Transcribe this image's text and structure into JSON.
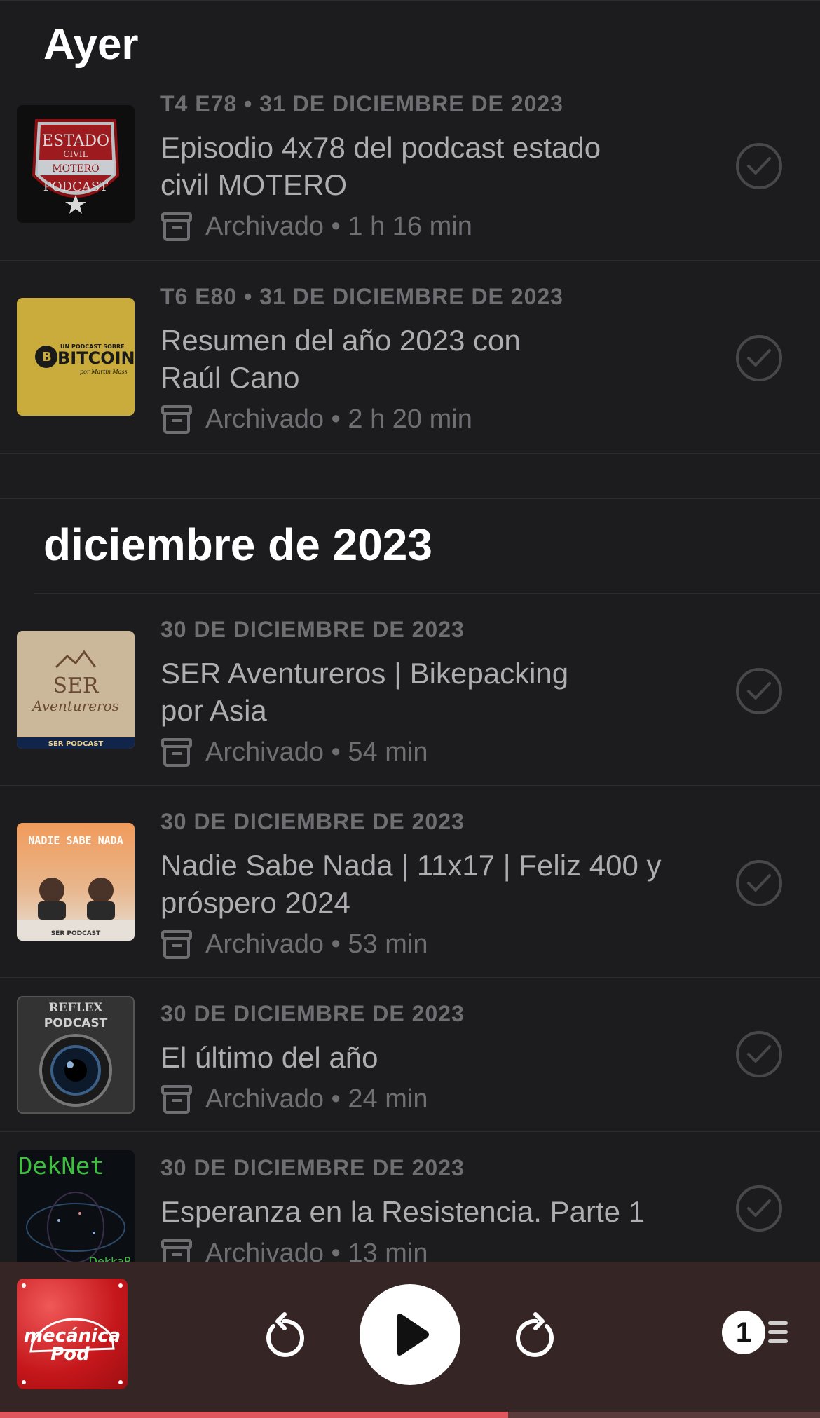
{
  "sections": [
    {
      "title": "Ayer",
      "episodes": [
        {
          "meta": "T4 E78 • 31 DE DICIEMBRE DE 2023",
          "title_line1": "Episodio 4x78 del podcast estado",
          "title_line2": "civil MOTERO",
          "status": "Archivado • 1 h 16 min",
          "artwork_text": [
            "ESTADO",
            "CIVIL",
            "MOTERO",
            "PODCAST"
          ]
        },
        {
          "meta": "T6 E80 • 31 DE DICIEMBRE DE 2023",
          "title_line1": "Resumen del año 2023 con",
          "title_line2": "Raúl Cano",
          "status": "Archivado • 2 h 20 min",
          "artwork_text": [
            "UN PODCAST SOBRE",
            "BITCOIN",
            "por Martín Mass"
          ]
        }
      ]
    },
    {
      "title": "diciembre de 2023",
      "episodes": [
        {
          "meta": "30 DE DICIEMBRE DE 2023",
          "title_line1": "SER Aventureros | Bikepacking",
          "title_line2": "por Asia",
          "status": "Archivado • 54 min",
          "artwork_text": [
            "SER",
            "Aventureros",
            "SER PODCAST"
          ]
        },
        {
          "meta": "30 DE DICIEMBRE DE 2023",
          "title_line1": "Nadie Sabe Nada | 11x17 | Feliz 400 y",
          "title_line2": "próspero 2024",
          "status": "Archivado • 53 min",
          "artwork_text": [
            "NADIE SABE NADA",
            "SER PODCAST"
          ]
        },
        {
          "meta": "30 DE DICIEMBRE DE 2023",
          "title_line1": "El último del año",
          "title_line2": "",
          "status": "Archivado • 24 min",
          "artwork_text": [
            "REFLEX",
            "PODCAST"
          ]
        },
        {
          "meta": "30 DE DICIEMBRE DE 2023",
          "title_line1": "Esperanza en la Resistencia. Parte 1",
          "title_line2": "",
          "status": "Archivado • 13 min",
          "artwork_text": [
            "DekNet",
            "DekkaR"
          ]
        }
      ]
    }
  ],
  "player": {
    "artwork_text": [
      "mecánica",
      "Pod"
    ],
    "queue_count": "1",
    "progress": 0.62
  },
  "colors": {
    "background": "#1c1c1e",
    "player_background": "#352525",
    "progress": "#e0585d"
  }
}
